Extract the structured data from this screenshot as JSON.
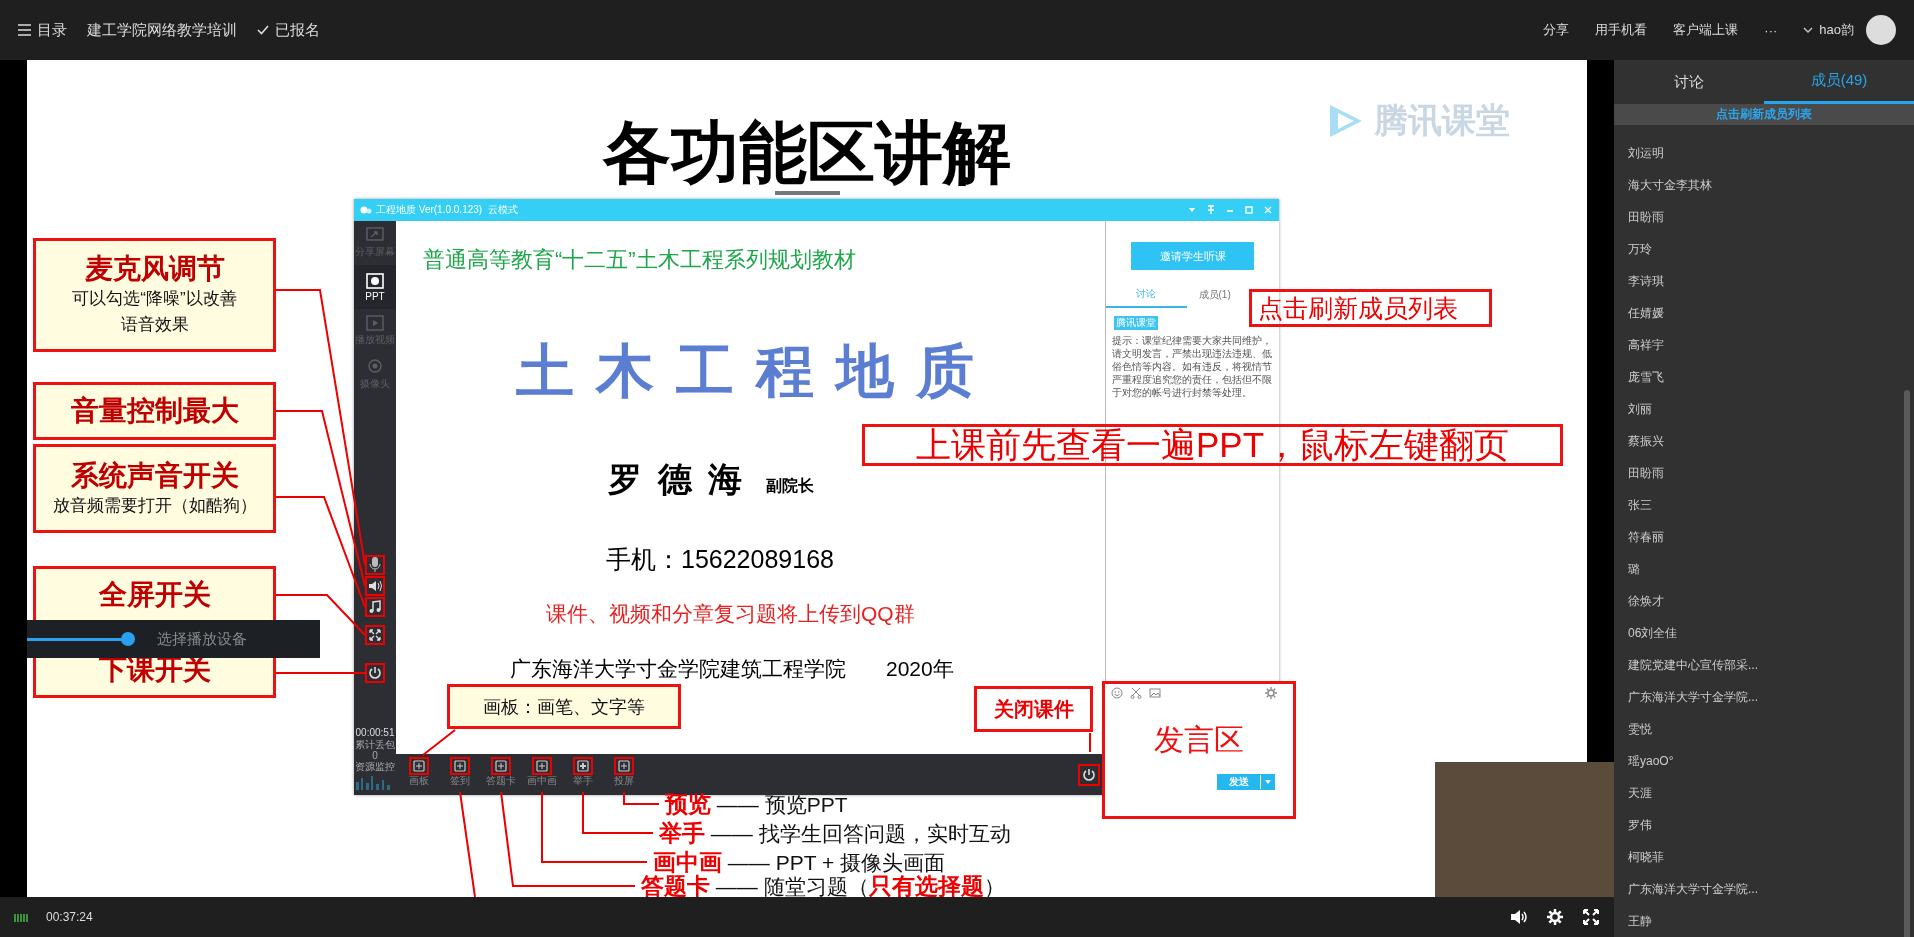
{
  "top_bar": {
    "menu_label": "目录",
    "course_title": "建工学院网络教学培训",
    "status_label": "已报名",
    "actions": [
      "分享",
      "用手机看",
      "客户端上课",
      "···"
    ],
    "user_name": "hao韵"
  },
  "slide": {
    "title": "各功能区讲解",
    "logo_text": "腾讯课堂",
    "app_window": {
      "title": "工程地质 Ver(1.0.0.123)  云模式",
      "nav_items": [
        {
          "label": "分享屏幕",
          "selected": false
        },
        {
          "label": "PPT",
          "selected": true
        },
        {
          "label": "播放视频",
          "selected": false
        },
        {
          "label": "摄像头",
          "selected": false
        }
      ],
      "timer": "00:00:51",
      "stats": [
        "累计丢包",
        "0",
        "资源监控"
      ],
      "slide_content": {
        "series": "普通高等教育“十二五”土木工程系列规划教材",
        "course_name": "土木工程地质",
        "author": "罗 德 海",
        "author_title": "副院长",
        "phone": "手机：15622089168",
        "notice": "课件、视频和分章复习题将上传到QQ群",
        "school": "广东海洋大学寸金学院建筑工程学院",
        "year": "2020年"
      },
      "toolbar": [
        {
          "label": "画板"
        },
        {
          "label": "签到"
        },
        {
          "label": "答题卡"
        },
        {
          "label": "画中画"
        },
        {
          "label": "举手"
        },
        {
          "label": "投屏"
        }
      ],
      "invite_button": "邀请学生听课",
      "panel_tabs": [
        {
          "label": "讨论",
          "selected": true
        },
        {
          "label": "成员(1)",
          "selected": false
        }
      ],
      "notice_badge": "腾讯课堂",
      "notice_text": "提示：课堂纪律需要大家共同维护，请文明发言，严禁出现违法违规、低俗色情等内容。如有违反，将视情节严重程度追究您的责任，包括但不限于对您的帐号进行封禁等处理。"
    },
    "side_callouts": [
      {
        "title": "麦克风调节",
        "note": "可以勾选“降噪”以改善语音效果"
      },
      {
        "title": "音量控制最大"
      },
      {
        "title": "系统声音开关",
        "note": "放音频需要打开（如酷狗）"
      },
      {
        "title": "全屏开关"
      },
      {
        "title": "下课开关"
      }
    ],
    "device_popup": {
      "label": "选择播放设备",
      "level": 0.9
    },
    "drawing_board_callout": "画板：画笔、文字等",
    "close_callout": "关闭课件",
    "refresh_callout": "点击刷新成员列表",
    "paging_callout": "上课前先查看一遍PPT，鼠标左键翻页",
    "chat_box": {
      "label": "发言区",
      "send_button": "发送"
    },
    "tool_notes": [
      "**预览** —— 预览PPT",
      "**举手** —— 找学生回答问题，实时互动",
      "**画中画** —— PPT + 摄像头画面",
      "**答题卡** —— 随堂习题（**只有选择题**）"
    ]
  },
  "player_bar": {
    "time": "00:37:24"
  },
  "sidebar": {
    "tabs": [
      {
        "label": "讨论",
        "selected": false
      },
      {
        "label": "成员(49)",
        "selected": true
      }
    ],
    "refresh_label": "点击刷新成员列表",
    "members": [
      "刘运明",
      "海大寸金李其林",
      "田盼雨",
      "万玲",
      "李诗琪",
      "任婧媛",
      "高祥宇",
      "庞雪飞",
      "刘丽",
      "蔡振兴",
      "田盼雨",
      "张三",
      "符春丽",
      "璐",
      "徐焕才",
      "06刘全佳",
      "建院党建中心宣传部采...",
      "广东海洋大学寸金学院...",
      "雯悦",
      "瑶yaoO°",
      "天涯",
      "罗伟",
      "柯晓菲",
      "广东海洋大学寸金学院...",
      "王静"
    ]
  }
}
